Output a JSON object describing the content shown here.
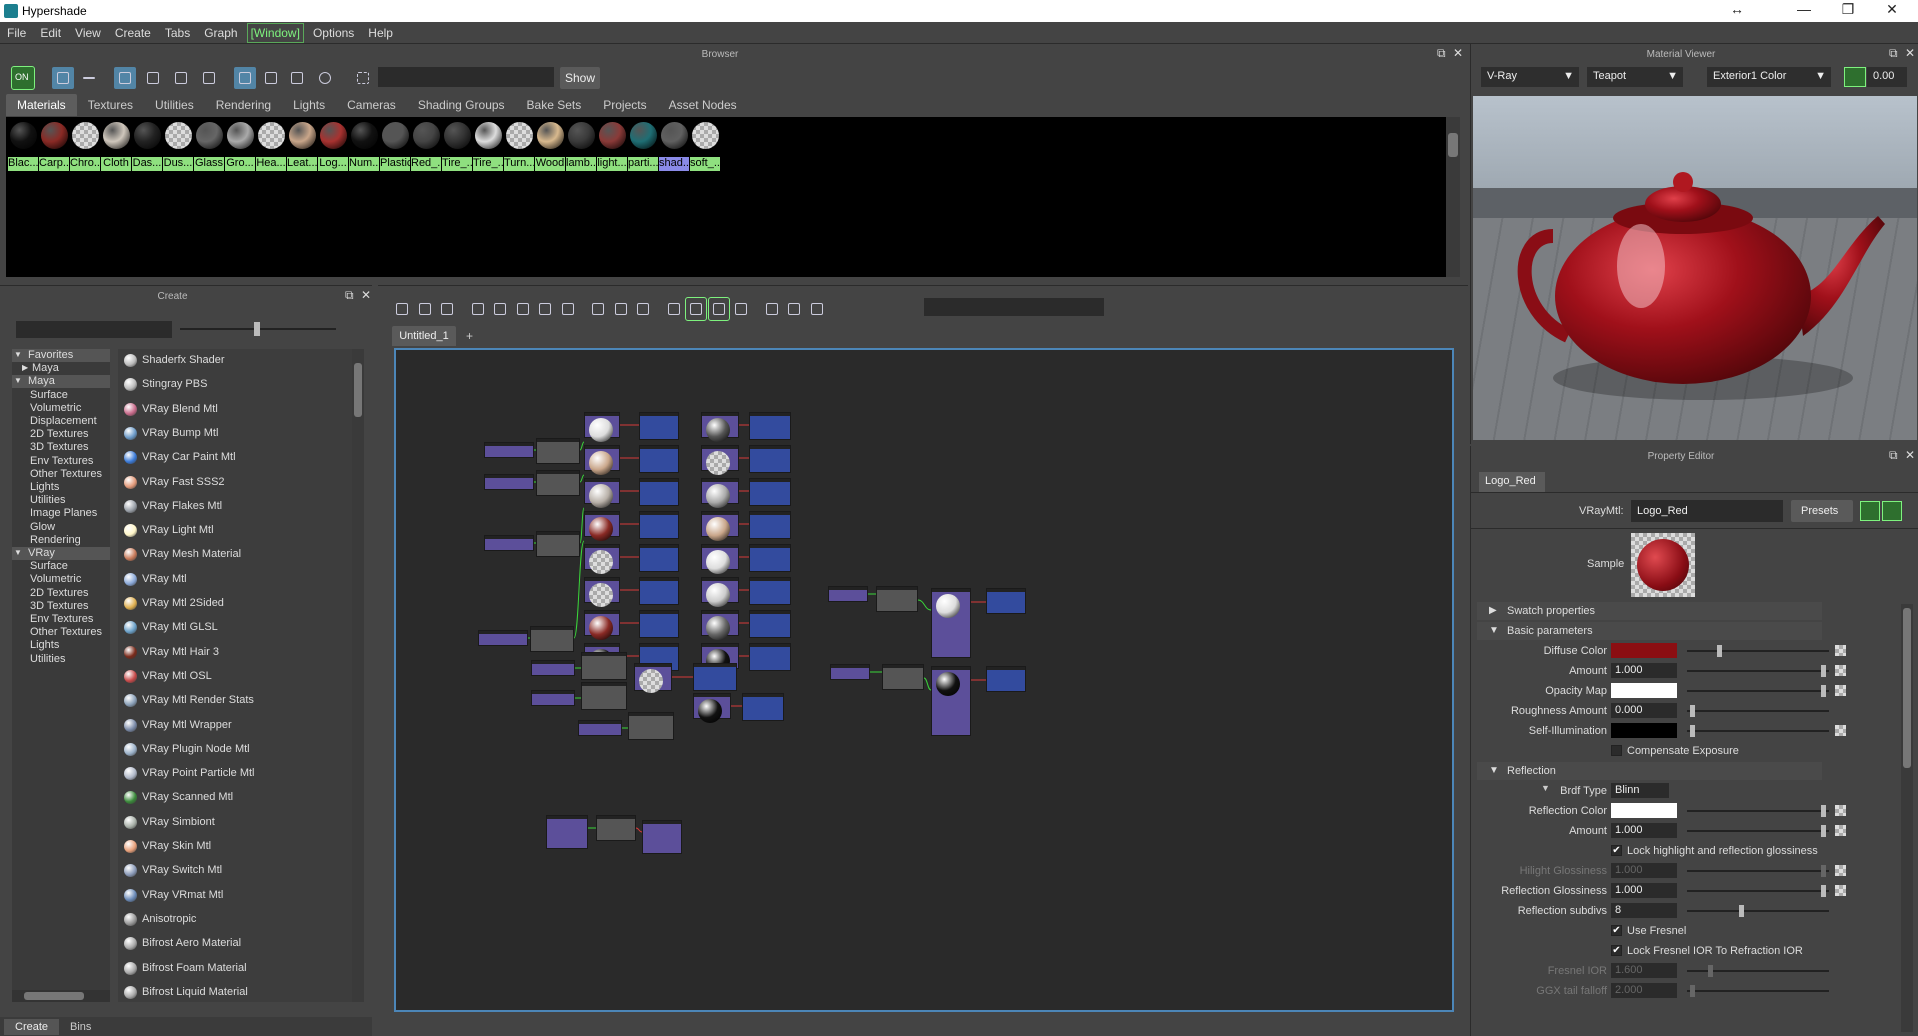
{
  "window": {
    "title": "Hypershade",
    "controls": [
      "↔",
      "—",
      "❐",
      "✕"
    ]
  },
  "menu": [
    "File",
    "Edit",
    "View",
    "Create",
    "Tabs",
    "Graph",
    "[Window]",
    "Options",
    "Help"
  ],
  "browser": {
    "title": "Browser",
    "show_label": "Show",
    "tabs": [
      "Materials",
      "Textures",
      "Utilities",
      "Rendering",
      "Lights",
      "Cameras",
      "Shading Groups",
      "Bake Sets",
      "Projects",
      "Asset Nodes"
    ],
    "selected_tab": "Materials",
    "swatches": [
      {
        "label": "Blac...",
        "color": "#111111"
      },
      {
        "label": "Carp...",
        "color": "#8a2a25"
      },
      {
        "label": "Chro...",
        "color": "checker"
      },
      {
        "label": "Cloth",
        "color": "#cfc7bc"
      },
      {
        "label": "Das...",
        "color": "#222222"
      },
      {
        "label": "Dus...",
        "color": "checker"
      },
      {
        "label": "Glass",
        "color": "#666666"
      },
      {
        "label": "Gro...",
        "color": "#aaaaaa"
      },
      {
        "label": "Hea...",
        "color": "checker"
      },
      {
        "label": "Leat...",
        "color": "#c9a68a"
      },
      {
        "label": "Log...",
        "color": "#a83230"
      },
      {
        "label": "Num...",
        "color": "#111111"
      },
      {
        "label": "Plastic",
        "color": "#555555"
      },
      {
        "label": "Red_...",
        "color": "#444444"
      },
      {
        "label": "Tire_...",
        "color": "#333333"
      },
      {
        "label": "Tire_...",
        "color": "#dddddd"
      },
      {
        "label": "Turn...",
        "color": "checker"
      },
      {
        "label": "Wood",
        "color": "#d8b98e"
      },
      {
        "label": "lamb...",
        "color": "#3a3a3a"
      },
      {
        "label": "light...",
        "color": "#8a3a38"
      },
      {
        "label": "parti...",
        "color": "#1f6e74"
      },
      {
        "label": "shad...",
        "color": "#606060"
      },
      {
        "label": "soft_...",
        "color": "checker"
      }
    ]
  },
  "create": {
    "title": "Create",
    "tree": [
      {
        "label": "Favorites",
        "indent": 1,
        "arrow": "▼",
        "header": true
      },
      {
        "label": "Maya",
        "indent": 2,
        "arrow": "▶",
        "header": false
      },
      {
        "label": "Maya",
        "indent": 1,
        "arrow": "▼",
        "header": true
      },
      {
        "label": "Surface",
        "indent": 3,
        "arrow": "",
        "header": false
      },
      {
        "label": "Volumetric",
        "indent": 3,
        "arrow": "",
        "header": false
      },
      {
        "label": "Displacement",
        "indent": 3,
        "arrow": "",
        "header": false
      },
      {
        "label": "2D Textures",
        "indent": 3,
        "arrow": "",
        "header": false
      },
      {
        "label": "3D Textures",
        "indent": 3,
        "arrow": "",
        "header": false
      },
      {
        "label": "Env Textures",
        "indent": 3,
        "arrow": "",
        "header": false
      },
      {
        "label": "Other Textures",
        "indent": 3,
        "arrow": "",
        "header": false
      },
      {
        "label": "Lights",
        "indent": 3,
        "arrow": "",
        "header": false
      },
      {
        "label": "Utilities",
        "indent": 3,
        "arrow": "",
        "header": false
      },
      {
        "label": "Image Planes",
        "indent": 3,
        "arrow": "",
        "header": false
      },
      {
        "label": "Glow",
        "indent": 3,
        "arrow": "",
        "header": false
      },
      {
        "label": "Rendering",
        "indent": 3,
        "arrow": "",
        "header": false
      },
      {
        "label": "VRay",
        "indent": 1,
        "arrow": "▼",
        "header": true
      },
      {
        "label": "Surface",
        "indent": 3,
        "arrow": "",
        "header": false
      },
      {
        "label": "Volumetric",
        "indent": 3,
        "arrow": "",
        "header": false
      },
      {
        "label": "2D Textures",
        "indent": 3,
        "arrow": "",
        "header": false
      },
      {
        "label": "3D Textures",
        "indent": 3,
        "arrow": "",
        "header": false
      },
      {
        "label": "Env Textures",
        "indent": 3,
        "arrow": "",
        "header": false
      },
      {
        "label": "Other Textures",
        "indent": 3,
        "arrow": "",
        "header": false
      },
      {
        "label": "Lights",
        "indent": 3,
        "arrow": "",
        "header": false
      },
      {
        "label": "Utilities",
        "indent": 3,
        "arrow": "",
        "header": false
      }
    ],
    "materials": [
      {
        "label": "Shaderfx Shader",
        "color": "#bbbbbb"
      },
      {
        "label": "Stingray PBS",
        "color": "#bbbbbb"
      },
      {
        "label": "VRay Blend Mtl",
        "color": "#c86a8a"
      },
      {
        "label": "VRay Bump Mtl",
        "color": "#6b9ac8"
      },
      {
        "label": "VRay Car Paint Mtl",
        "color": "#3a7ad8"
      },
      {
        "label": "VRay Fast SSS2",
        "color": "#e39a7a"
      },
      {
        "label": "VRay Flakes Mtl",
        "color": "#9aa0a8"
      },
      {
        "label": "VRay Light Mtl",
        "color": "#fff6c8"
      },
      {
        "label": "VRay Mesh Material",
        "color": "#c87a5a"
      },
      {
        "label": "VRay Mtl",
        "color": "#8aa8d8"
      },
      {
        "label": "VRay Mtl 2Sided",
        "color": "#e0b050"
      },
      {
        "label": "VRay Mtl GLSL",
        "color": "#6aa0c8"
      },
      {
        "label": "VRay Mtl Hair 3",
        "color": "#7a2a1a"
      },
      {
        "label": "VRay Mtl OSL",
        "color": "#c84a4a"
      },
      {
        "label": "VRay Mtl Render Stats",
        "color": "#8aa0b8"
      },
      {
        "label": "VRay Mtl Wrapper",
        "color": "#7a8aa8"
      },
      {
        "label": "VRay Plugin Node Mtl",
        "color": "#9ab0c8"
      },
      {
        "label": "VRay Point Particle Mtl",
        "color": "#b0b8c8"
      },
      {
        "label": "VRay Scanned Mtl",
        "color": "#3a8a3a"
      },
      {
        "label": "VRay Simbiont",
        "color": "#a8b0a8"
      },
      {
        "label": "VRay Skin Mtl",
        "color": "#e8a07a"
      },
      {
        "label": "VRay Switch Mtl",
        "color": "#8a9ab8"
      },
      {
        "label": "VRay VRmat Mtl",
        "color": "#6a8ab8"
      },
      {
        "label": "Anisotropic",
        "color": "#999999"
      },
      {
        "label": "Bifrost Aero Material",
        "color": "#aaaaaa"
      },
      {
        "label": "Bifrost Foam Material",
        "color": "#aaaaaa"
      },
      {
        "label": "Bifrost Liquid Material",
        "color": "#aaaaaa"
      }
    ],
    "bottom_tabs": [
      "Create",
      "Bins"
    ]
  },
  "graph": {
    "tab_label": "Untitled_1",
    "add_tab": "+"
  },
  "material_viewer": {
    "title": "Material Viewer",
    "renderer": "V-Ray",
    "geometry": "Teapot",
    "environment": "Exterior1 Color",
    "exposure": "0.00"
  },
  "property_editor": {
    "title": "Property Editor",
    "tab": "Logo_Red",
    "type_label": "VRayMtl:",
    "name": "Logo_Red",
    "presets": "Presets",
    "sample_label": "Sample",
    "sections": {
      "swatch": "Swatch properties",
      "basic": "Basic parameters",
      "reflection": "Reflection"
    },
    "basic": [
      {
        "label": "Diffuse Color",
        "kind": "color",
        "color": "#8b0e12",
        "slider": 0.22
      },
      {
        "label": "Amount",
        "kind": "value",
        "value": "1.000",
        "slider": 0.98
      },
      {
        "label": "Opacity Map",
        "kind": "color",
        "color": "#ffffff",
        "slider": 0.98
      },
      {
        "label": "Roughness Amount",
        "kind": "value",
        "value": "0.000",
        "slider": 0.02
      },
      {
        "label": "Self-Illumination",
        "kind": "color",
        "color": "#000000",
        "slider": 0.02
      }
    ],
    "compensate_exposure": "Compensate Exposure",
    "brdf_label": "Brdf Type",
    "brdf_value": "Blinn",
    "reflection": [
      {
        "label": "Reflection Color",
        "kind": "color",
        "color": "#ffffff",
        "slider": 0.98,
        "dim": false
      },
      {
        "label": "Amount",
        "kind": "value",
        "value": "1.000",
        "slider": 0.98,
        "dim": false
      }
    ],
    "lock_highlight": "Lock highlight and reflection glossiness",
    "reflection2": [
      {
        "label": "Hilight Glossiness",
        "kind": "value",
        "value": "1.000",
        "slider": 0.98,
        "dim": true
      },
      {
        "label": "Reflection Glossiness",
        "kind": "value",
        "value": "1.000",
        "slider": 0.98,
        "dim": false
      },
      {
        "label": "Reflection subdivs",
        "kind": "value",
        "value": "8",
        "slider": 0.38,
        "dim": false
      }
    ],
    "use_fresnel": "Use Fresnel",
    "lock_fresnel": "Lock Fresnel IOR To Refraction IOR",
    "reflection3": [
      {
        "label": "Fresnel IOR",
        "kind": "value",
        "value": "1.600",
        "slider": 0.15,
        "dim": true
      },
      {
        "label": "GGX tail falloff",
        "kind": "value",
        "value": "2.000",
        "slider": 0.02,
        "dim": true
      }
    ]
  }
}
